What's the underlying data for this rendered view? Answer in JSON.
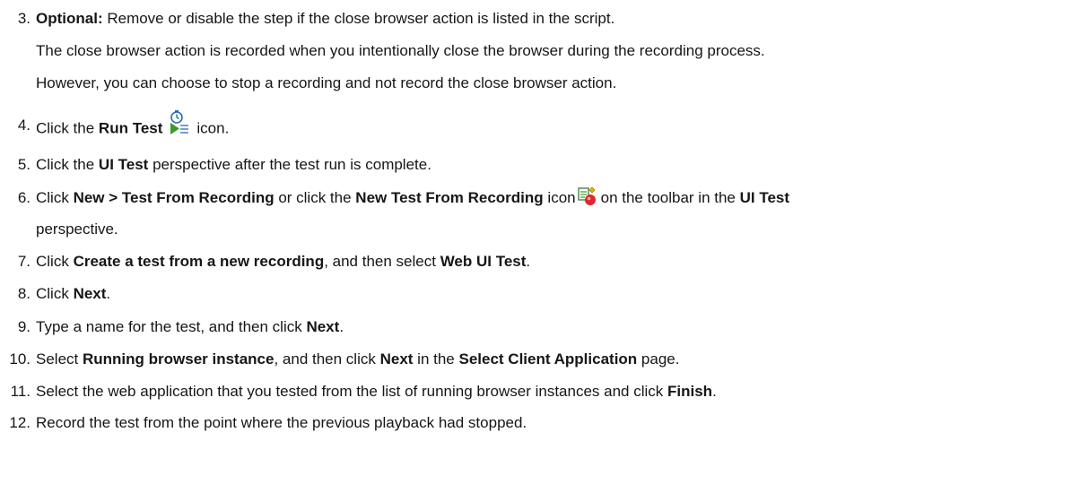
{
  "steps": {
    "s3": {
      "num": "3.",
      "label": "Optional:",
      "text": " Remove or disable the step if the close browser action is listed in the script.",
      "para_line1": "The close browser action is recorded when you intentionally close the browser during the recording process.",
      "para_line2": "However, you can choose to stop a recording and not record the close browser action."
    },
    "s4": {
      "num": "4.",
      "pre": "Click the ",
      "bold": "Run Test",
      "icon": "run-test-icon",
      "post": "icon."
    },
    "s5": {
      "num": "5.",
      "pre": "Click the ",
      "bold": "UI Test",
      "post": " perspective after the test run is complete."
    },
    "s6": {
      "num": "6.",
      "pre": "Click ",
      "bold1": "New > Test From Recording",
      "mid1": " or click the ",
      "bold2": "New Test From Recording",
      "mid2": " icon",
      "icon": "new-test-from-recording-icon",
      "mid3": "on the toolbar in the ",
      "bold3": "UI Test",
      "line2": "perspective."
    },
    "s7": {
      "num": "7.",
      "pre": "Click ",
      "bold1": "Create a test from a new recording",
      "mid": ", and then select ",
      "bold2": "Web UI Test",
      "post": "."
    },
    "s8": {
      "num": "8.",
      "pre": "Click ",
      "bold": "Next",
      "post": "."
    },
    "s9": {
      "num": "9.",
      "pre": "Type a name for the test, and then click ",
      "bold": "Next",
      "post": "."
    },
    "s10": {
      "num": "10.",
      "pre": "Select ",
      "bold1": "Running browser instance",
      "mid": ", and then click ",
      "bold2": "Next",
      "mid2": " in the ",
      "bold3": "Select Client Application",
      "post": " page."
    },
    "s11": {
      "num": "11.",
      "pre": "Select the web application that you tested from the list of running browser instances and click ",
      "bold": "Finish",
      "post": "."
    },
    "s12": {
      "num": "12.",
      "text": "Record the test from the point where the previous playback had stopped."
    }
  },
  "colors": {
    "text": "#161616",
    "icon_green": "#3a9a2a",
    "icon_blue": "#2b6cb0",
    "icon_red": "#e0282e"
  }
}
